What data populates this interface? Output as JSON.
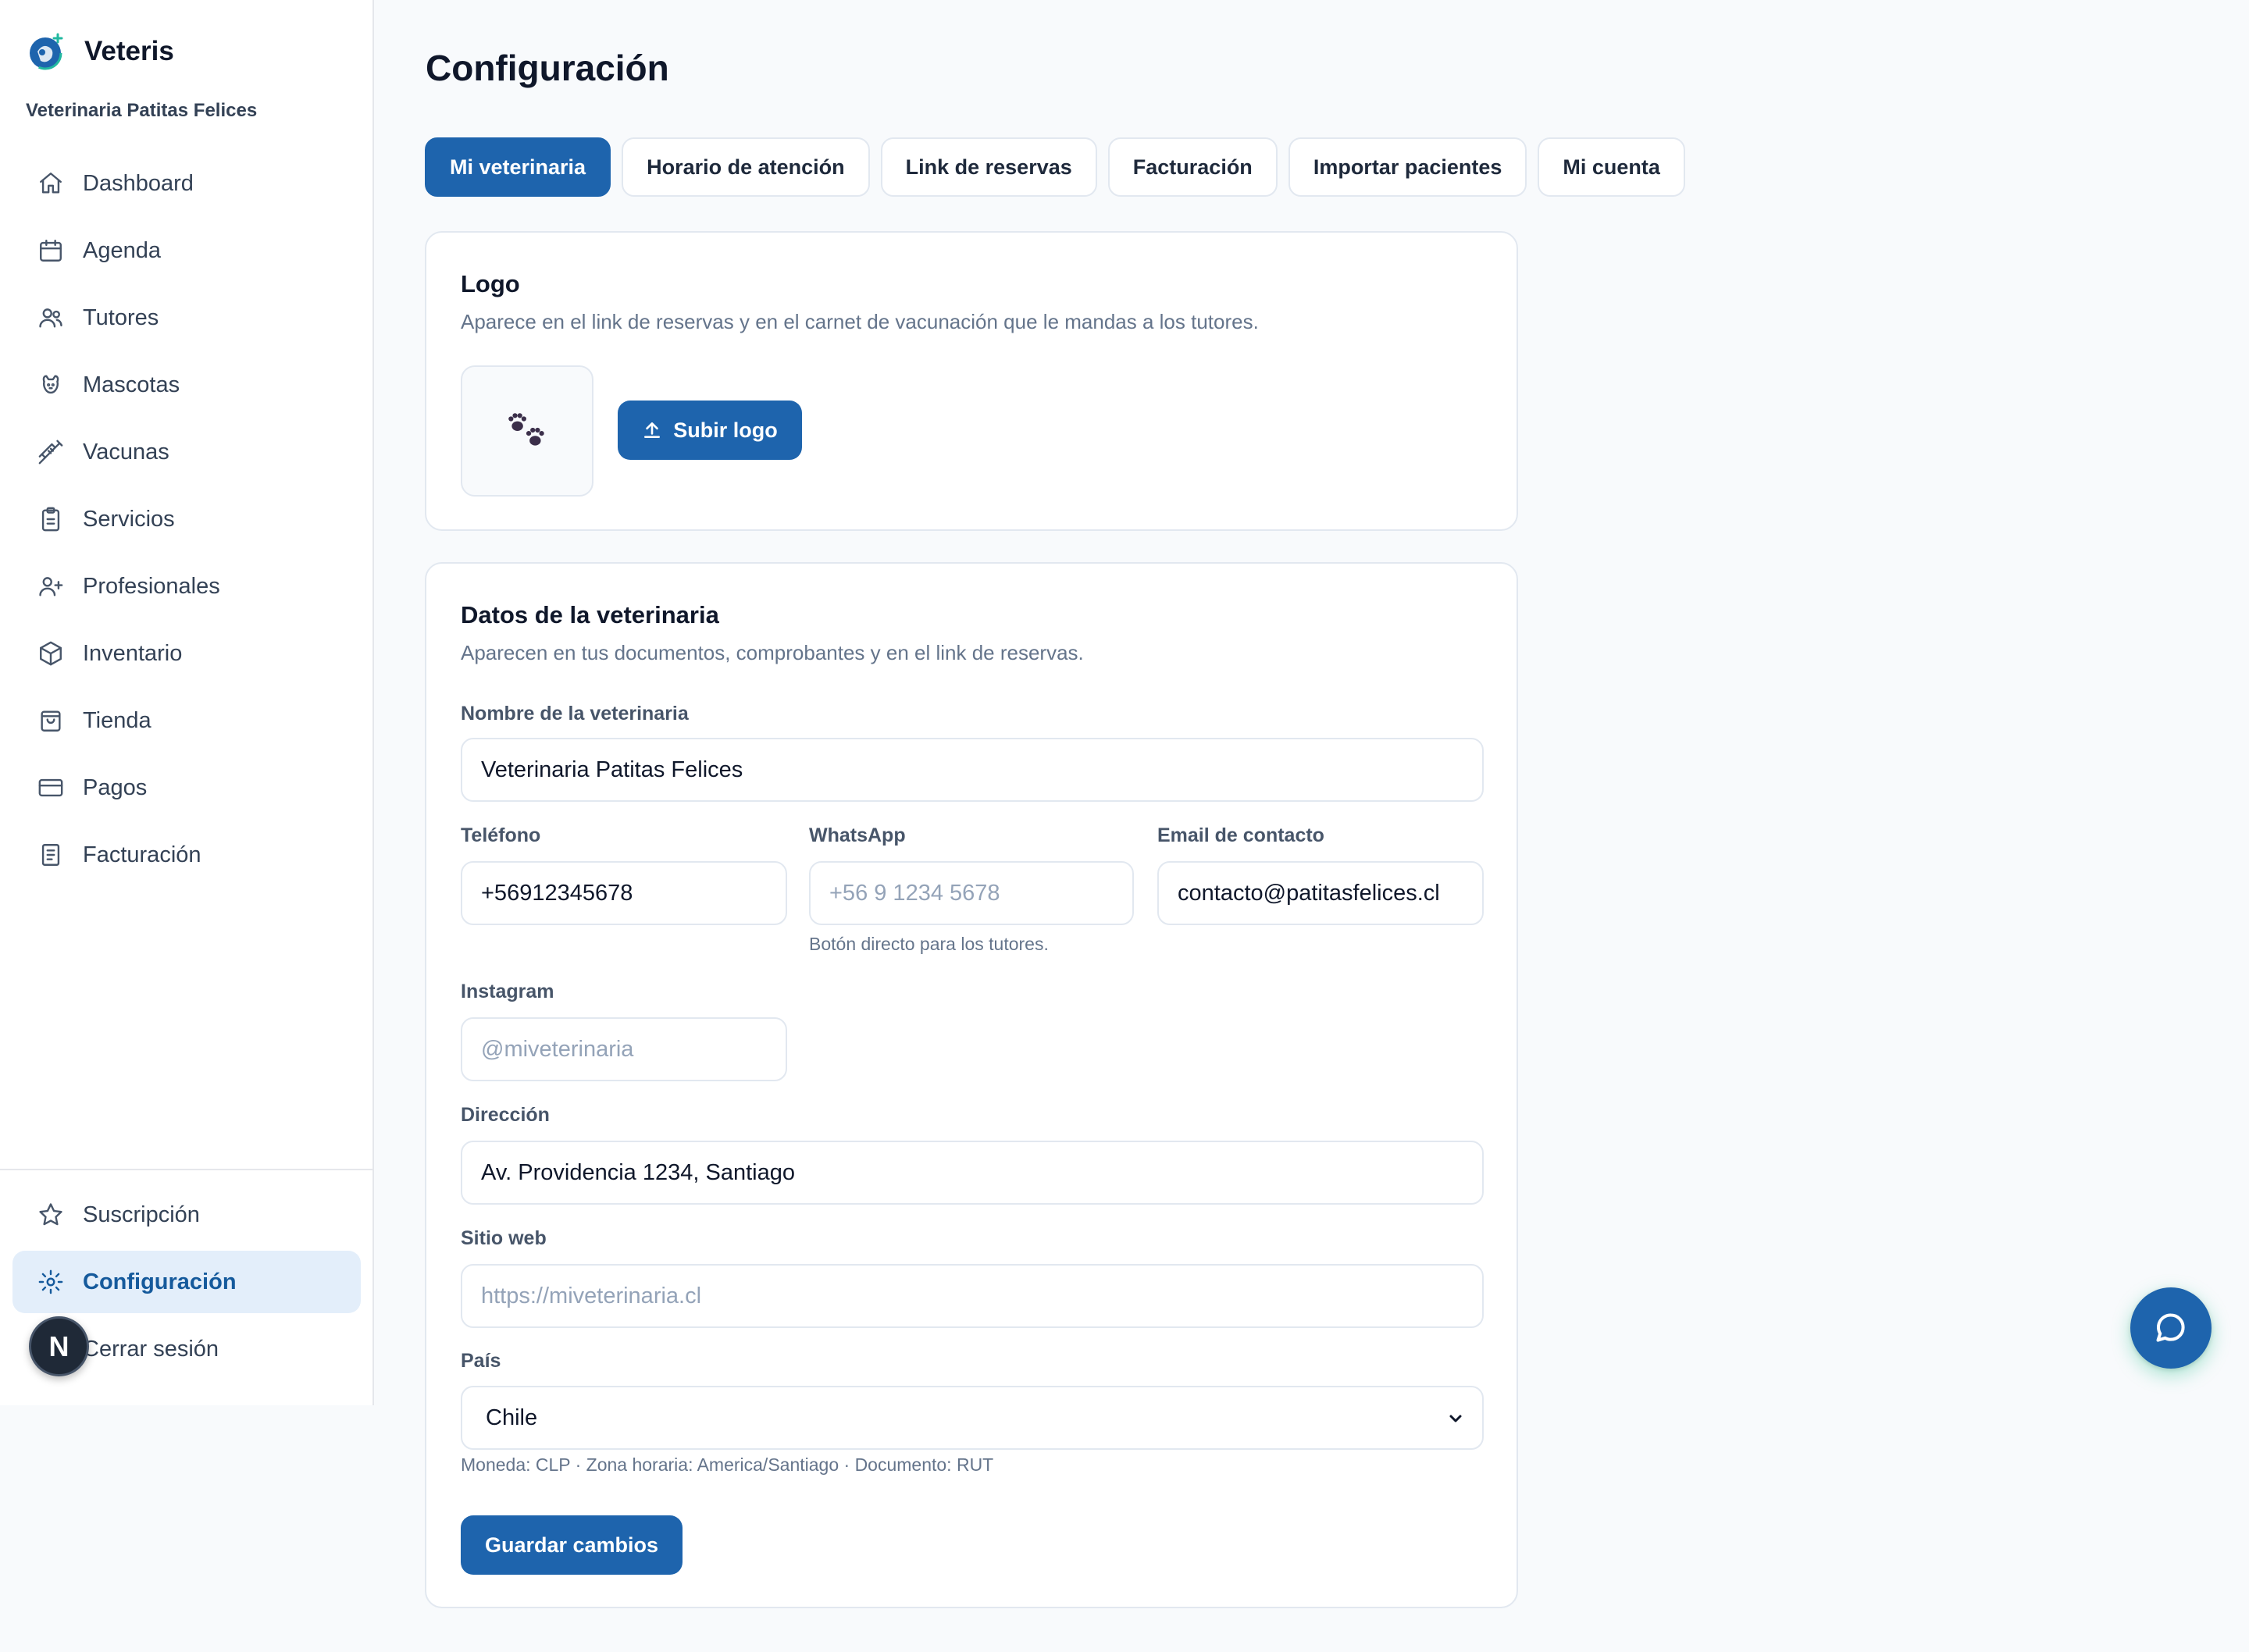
{
  "brand": {
    "name": "Veteris",
    "clinic": "Veterinaria Patitas Felices"
  },
  "nav": {
    "items": [
      {
        "label": "Dashboard",
        "icon": "home-icon"
      },
      {
        "label": "Agenda",
        "icon": "calendar-icon"
      },
      {
        "label": "Tutores",
        "icon": "users-icon"
      },
      {
        "label": "Mascotas",
        "icon": "pet-icon"
      },
      {
        "label": "Vacunas",
        "icon": "syringe-icon"
      },
      {
        "label": "Servicios",
        "icon": "clipboard-icon"
      },
      {
        "label": "Profesionales",
        "icon": "user-plus-icon"
      },
      {
        "label": "Inventario",
        "icon": "box-icon"
      },
      {
        "label": "Tienda",
        "icon": "shopping-bag-icon"
      },
      {
        "label": "Pagos",
        "icon": "credit-card-icon"
      },
      {
        "label": "Facturación",
        "icon": "receipt-icon"
      }
    ],
    "bottom": [
      {
        "label": "Suscripción",
        "icon": "star-icon"
      },
      {
        "label": "Configuración",
        "icon": "settings-icon",
        "active": true
      },
      {
        "label": "Cerrar sesión",
        "icon": "logout-icon"
      }
    ],
    "badge": "N"
  },
  "page": {
    "title": "Configuración"
  },
  "tabs": [
    "Mi veterinaria",
    "Horario de atención",
    "Link de reservas",
    "Facturación",
    "Importar pacientes",
    "Mi cuenta"
  ],
  "logo_card": {
    "title": "Logo",
    "description": "Aparece en el link de reservas y en el carnet de vacunación que le mandas a los tutores.",
    "upload_label": "Subir logo"
  },
  "datos_card": {
    "title": "Datos de la veterinaria",
    "description": "Aparecen en tus documentos, comprobantes y en el link de reservas.",
    "nombre": {
      "label": "Nombre de la veterinaria",
      "value": "Veterinaria Patitas Felices"
    },
    "telefono": {
      "label": "Teléfono",
      "value": "+56912345678"
    },
    "whatsapp": {
      "label": "WhatsApp",
      "placeholder": "+56 9 1234 5678",
      "hint": "Botón directo para los tutores."
    },
    "email": {
      "label": "Email de contacto",
      "value": "contacto@patitasfelices.cl"
    },
    "instagram": {
      "label": "Instagram",
      "placeholder": "@miveterinaria"
    },
    "direccion": {
      "label": "Dirección",
      "value": "Av. Providencia 1234, Santiago"
    },
    "sitio": {
      "label": "Sitio web",
      "placeholder": "https://miveterinaria.cl"
    },
    "pais": {
      "label": "País",
      "value": "Chile",
      "hint": "Moneda: CLP · Zona horaria: America/Santiago · Documento: RUT"
    },
    "save_label": "Guardar cambios"
  },
  "colors": {
    "primary": "#1e64ad",
    "active_bg": "#e3eefa",
    "active_text": "#155a9c"
  }
}
